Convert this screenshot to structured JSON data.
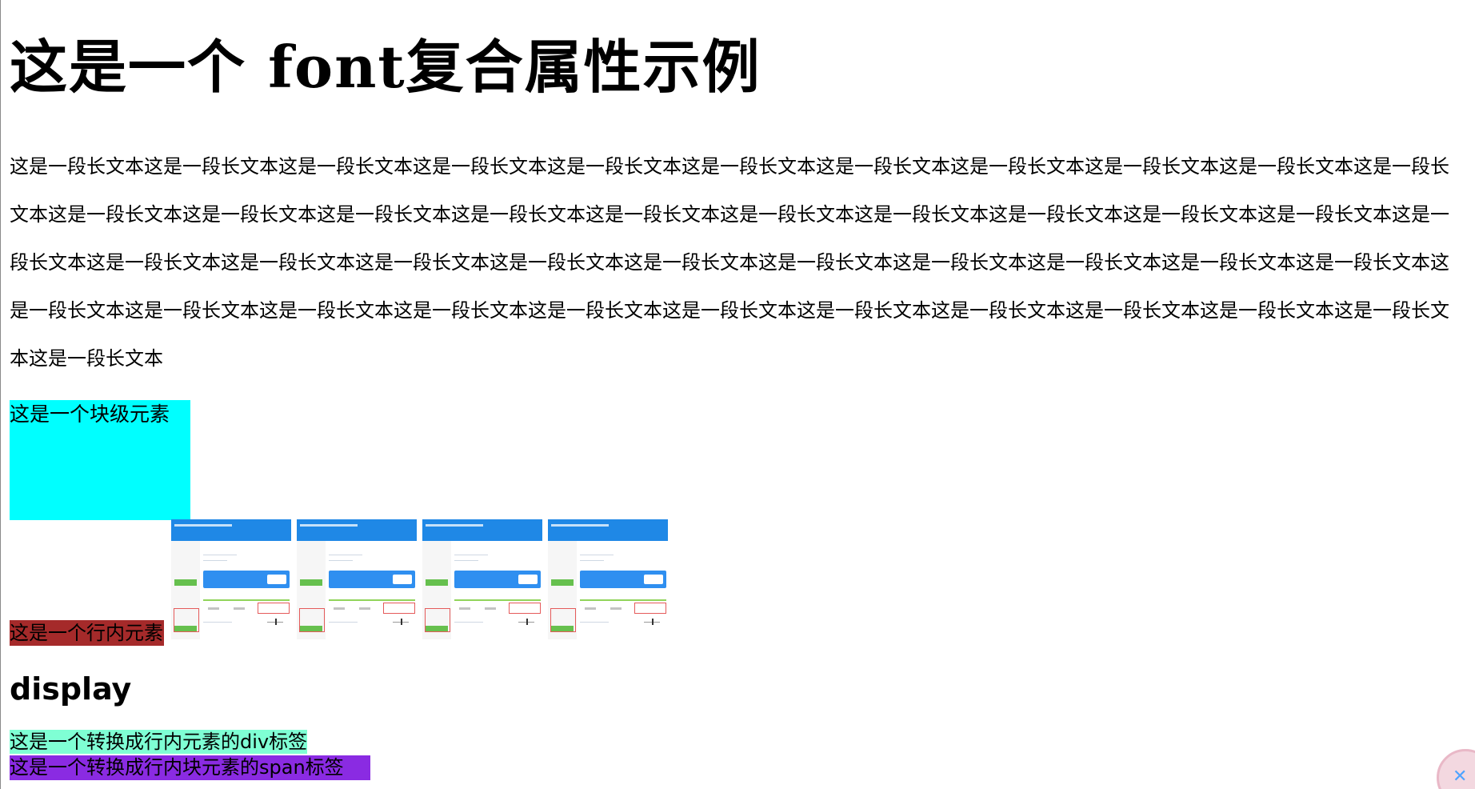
{
  "page": {
    "title": "这是一个 font复合属性示例",
    "paragraph": "这是一段长文本这是一段长文本这是一段长文本这是一段长文本这是一段长文本这是一段长文本这是一段长文本这是一段长文本这是一段长文本这是一段长文本这是一段长文本这是一段长文本这是一段长文本这是一段长文本这是一段长文本这是一段长文本这是一段长文本这是一段长文本这是一段长文本这是一段长文本这是一段长文本这是一段长文本这是一段长文本这是一段长文本这是一段长文本这是一段长文本这是一段长文本这是一段长文本这是一段长文本这是一段长文本这是一段长文本这是一段长文本这是一段长文本这是一段长文本这是一段长文本这是一段长文本这是一段长文本这是一段长文本这是一段长文本这是一段长文本这是一段长文本这是一段长文本这是一段长文本这是一段长文本",
    "block_element": "这是一个块级元素",
    "inline_element": "这是一个行内元素",
    "section_heading": "display",
    "inline_div": "这是一个转换成行内元素的div标签",
    "inline_block_span": "这是一个转换成行内块元素的span标签"
  },
  "images": [
    {
      "name": "app-screenshot-thumbnail"
    },
    {
      "name": "app-screenshot-thumbnail"
    },
    {
      "name": "app-screenshot-thumbnail"
    },
    {
      "name": "app-screenshot-thumbnail"
    }
  ],
  "colors": {
    "block_element_bg": "#00ffff",
    "inline_element_bg": "#a52a2a",
    "inline_div_bg": "#7fffd4",
    "inline_block_span_bg": "#8a2be2",
    "thumb_header": "#1f88e6"
  },
  "widgets": {
    "floating_widget_icon": "mascot-icon"
  }
}
